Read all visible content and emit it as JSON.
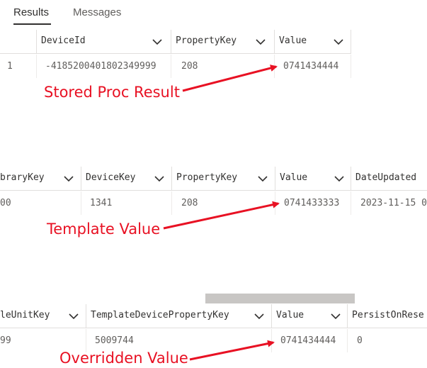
{
  "tabs": [
    {
      "label": "Results"
    },
    {
      "label": "Messages"
    }
  ],
  "grid1": {
    "columns": [
      "DeviceId",
      "PropertyKey",
      "Value"
    ],
    "rows": [
      [
        "1",
        "-4185200401802349999",
        "208",
        "0741434444"
      ]
    ]
  },
  "grid2": {
    "columns": [
      "braryKey",
      "DeviceKey",
      "PropertyKey",
      "Value",
      "DateUpdated"
    ],
    "rows": [
      [
        "00",
        "1341",
        "208",
        "0741433333",
        "2023-11-15 0"
      ]
    ]
  },
  "grid3": {
    "columns": [
      "leUnitKey",
      "TemplateDevicePropertyKey",
      "Value",
      "PersistOnRese"
    ],
    "rows": [
      [
        "99",
        "5009744",
        "0741434444",
        "0"
      ]
    ]
  },
  "annotations": {
    "stored_proc": "Stored Proc Result",
    "template": "Template Value",
    "overridden": "Overridden Value"
  },
  "colors": {
    "annotation": "#e81123",
    "accent": "#323130"
  }
}
